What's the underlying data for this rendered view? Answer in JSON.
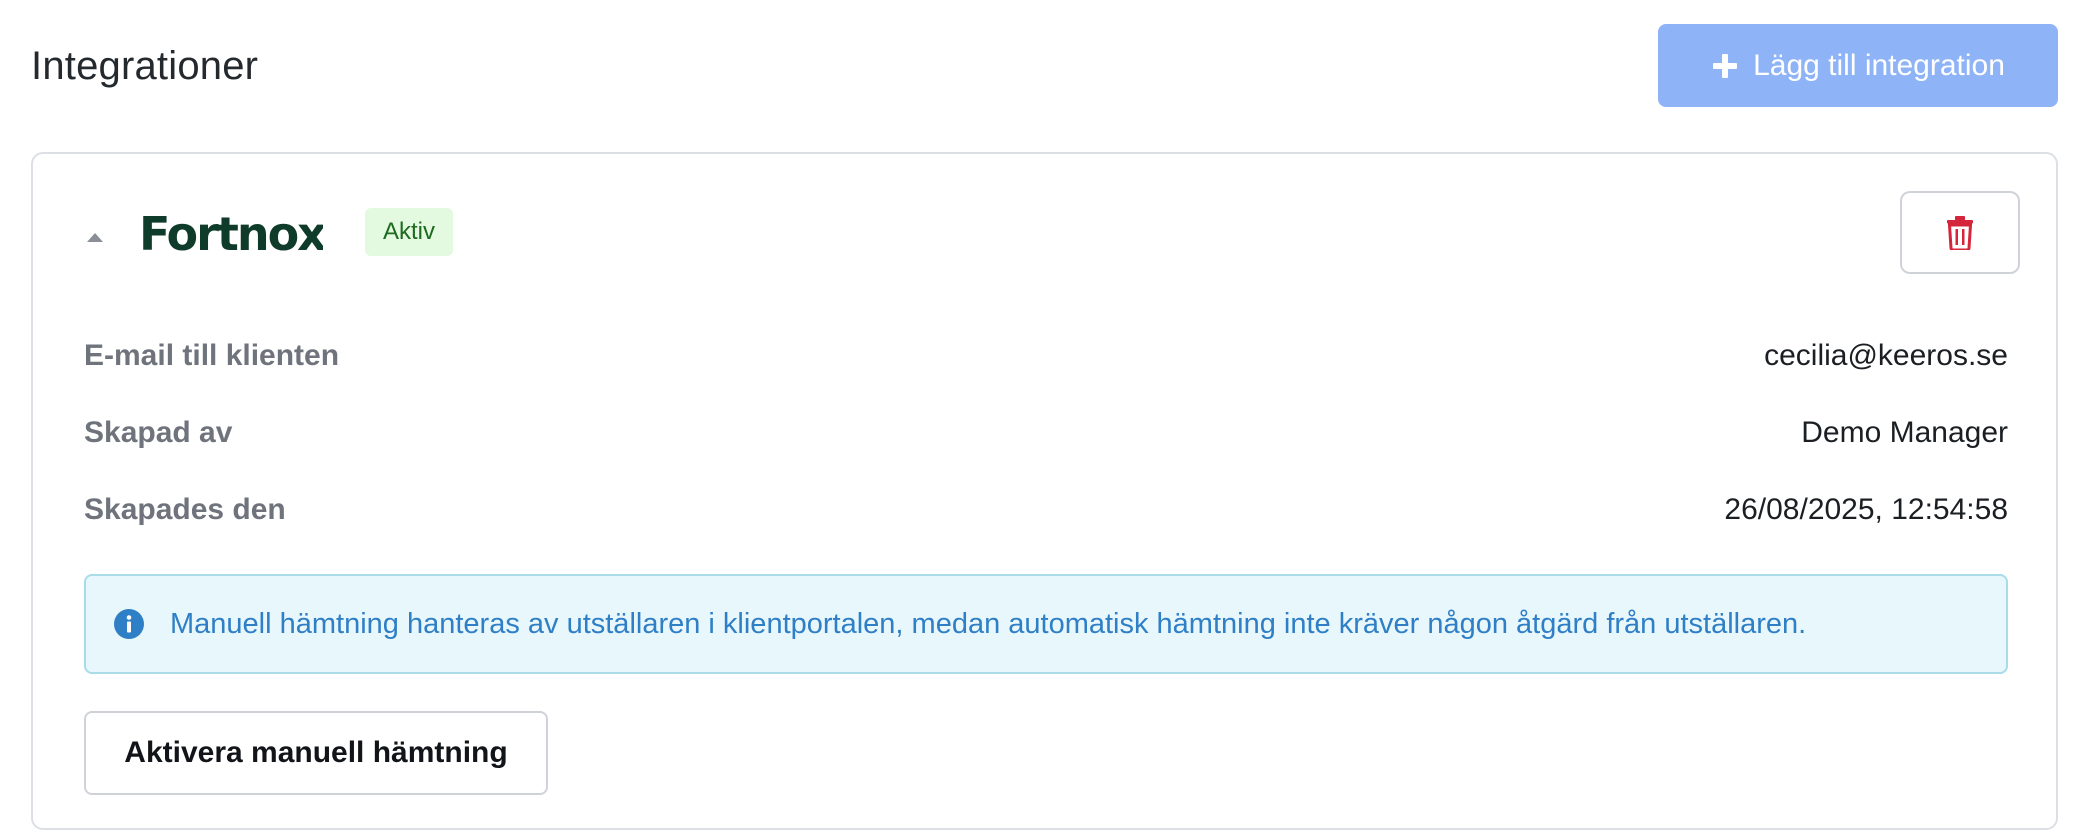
{
  "page": {
    "title": "Integrationer",
    "add_button_label": "Lägg till integration"
  },
  "integration": {
    "logo_text": "Fortnox",
    "status": "Aktiv",
    "details": [
      {
        "label": "E-mail till klienten",
        "value": "cecilia@keeros.se"
      },
      {
        "label": "Skapad av",
        "value": "Demo Manager"
      },
      {
        "label": "Skapades den",
        "value": "26/08/2025, 12:54:58"
      }
    ],
    "info_message": "Manuell hämtning hanteras av utställaren i klientportalen, medan automatisk hämtning inte kräver någon åtgärd från utställaren.",
    "manual_button_label": "Aktivera manuell hämtning"
  },
  "icons": {
    "add": "plus-icon",
    "collapse": "caret-up-icon",
    "delete": "trash-icon",
    "info": "info-icon"
  },
  "colors": {
    "primary_button": "#8fb3f7",
    "status_bg": "#e3f9e0",
    "status_text": "#1c6b1e",
    "danger": "#d5253b",
    "info_bg": "#e8f7fc",
    "info_border": "#a9dbe8",
    "info_text": "#2f7fc6",
    "logo": "#0f3b2a"
  }
}
